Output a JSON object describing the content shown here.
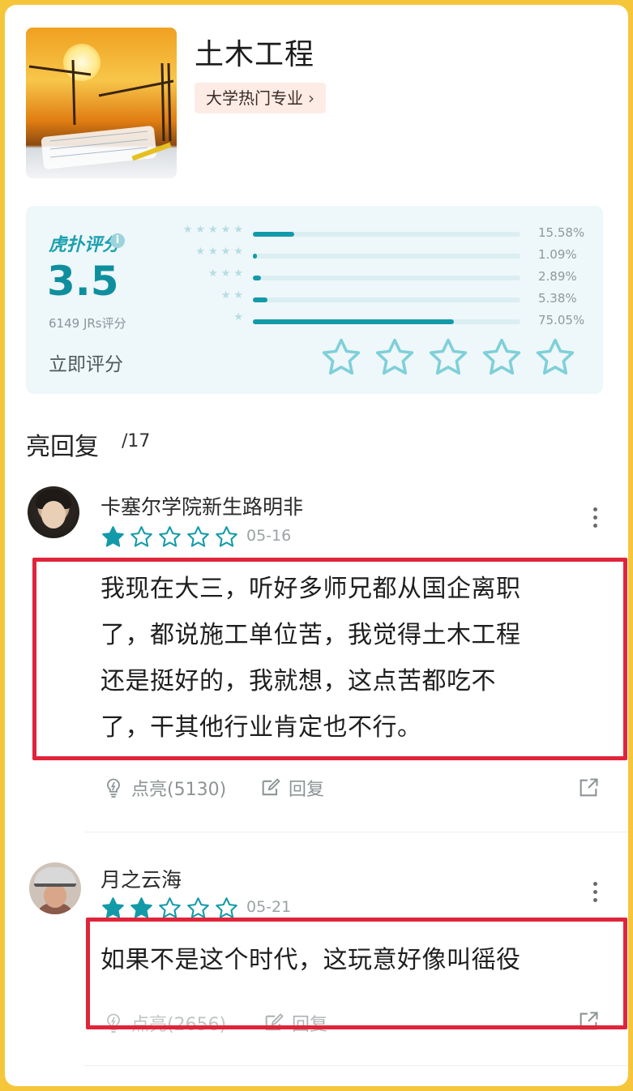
{
  "header": {
    "title": "土木工程",
    "tag_label": "大学热门专业",
    "tag_chevron": "›"
  },
  "rating": {
    "label": "虎扑评分",
    "info_icon": "i",
    "score": "3.5",
    "count": "6149 JRs评分",
    "rate_now": "立即评分",
    "distribution": [
      {
        "stars": 5,
        "percent_label": "15.58%",
        "percent": 15.58
      },
      {
        "stars": 4,
        "percent_label": "1.09%",
        "percent": 1.09
      },
      {
        "stars": 3,
        "percent_label": "2.89%",
        "percent": 2.89
      },
      {
        "stars": 2,
        "percent_label": "5.38%",
        "percent": 5.38
      },
      {
        "stars": 1,
        "percent_label": "75.05%",
        "percent": 75.05
      }
    ],
    "accent_color": "#139aa9"
  },
  "replies": {
    "title": "亮回复",
    "count": "/17",
    "items": [
      {
        "user": "卡塞尔学院新生路明非",
        "stars": 1,
        "date": "05-16",
        "lines": [
          "我现在大三，听好多师兄都从国企离职",
          "了，都说施工单位苦，我觉得土木工程",
          "还是挺好的，我就想，这点苦都吃不",
          "了，干其他行业肯定也不行。"
        ],
        "like_label": "点亮(5130)",
        "reply_label": "回复"
      },
      {
        "user": "月之云海",
        "stars": 2,
        "date": "05-21",
        "lines": [
          "如果不是这个时代，这玩意好像叫徭役"
        ],
        "like_label": "点亮(2656)",
        "reply_label": "回复"
      }
    ]
  },
  "colors": {
    "highlight_box": "#e0243a",
    "page_bg": "#f6c63a"
  }
}
